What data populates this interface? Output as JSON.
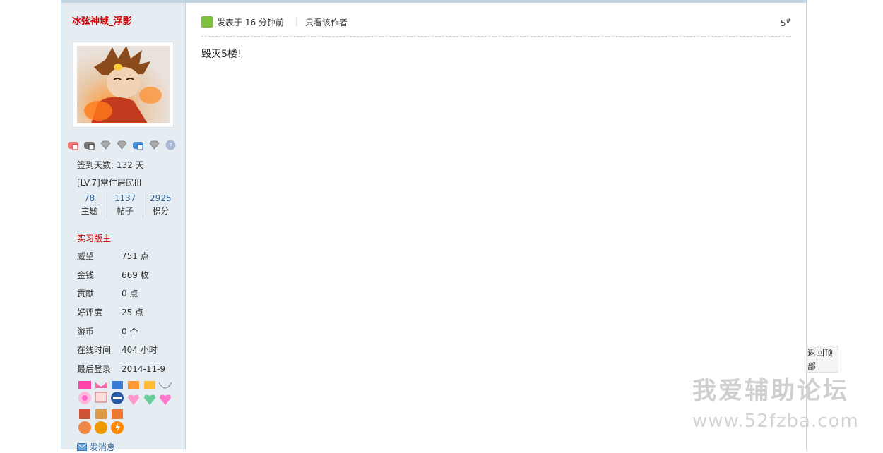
{
  "user": {
    "name": "冰弦神域_浮影",
    "checkin": "签到天数: 132 天",
    "level": "[LV.7]常住居民III",
    "stats": [
      {
        "num": "78",
        "label": "主题"
      },
      {
        "num": "1137",
        "label": "帖子"
      },
      {
        "num": "2925",
        "label": "积分"
      }
    ],
    "role": "实习版主",
    "info": [
      {
        "key": "威望",
        "value": "751 点"
      },
      {
        "key": "金钱",
        "value": "669 枚"
      },
      {
        "key": "贡献",
        "value": "0 点"
      },
      {
        "key": "好评度",
        "value": "25 点"
      },
      {
        "key": "游币",
        "value": "0 个"
      },
      {
        "key": "在线时间",
        "value": "404 小时"
      },
      {
        "key": "最后登录",
        "value": "2014-11-9"
      }
    ],
    "send_message": "发消息",
    "badges": [
      "red-medal-icon",
      "dark-medal-icon",
      "silver-gem-icon",
      "silver-gem-icon",
      "blue-medal-icon",
      "silver-gem-icon",
      "question-icon"
    ]
  },
  "post": {
    "time": "发表于 16 分钟前",
    "separator": "|",
    "author_only": "只看该作者",
    "floor": "5",
    "floor_mark": "#",
    "body": "毁灭5楼!"
  },
  "back_to_top": "返回顶部",
  "watermark": {
    "title": "我爱辅助论坛",
    "url": "www.52fzba.com"
  },
  "colors": {
    "sidebar_bg": "#e5edf2",
    "border": "#c2d5e3",
    "username": "#cc0000",
    "link": "#336699"
  }
}
